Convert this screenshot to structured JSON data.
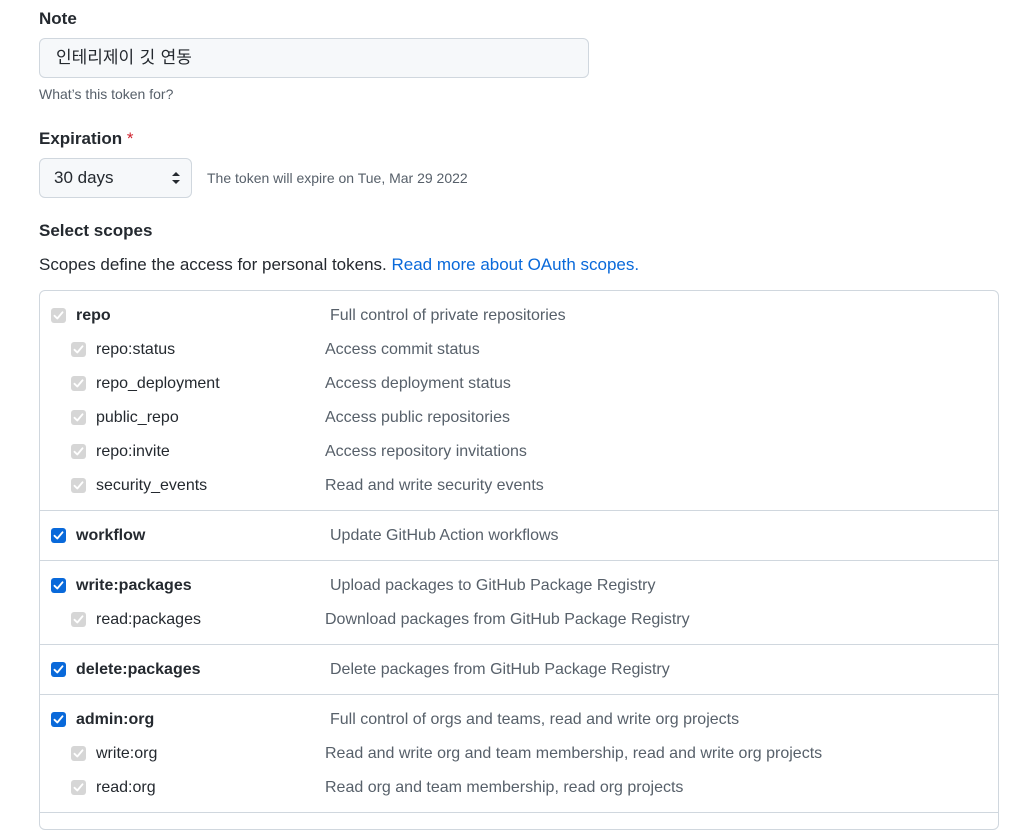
{
  "note": {
    "label": "Note",
    "value": "인테리제이 깃 연동",
    "hint": "What’s this token for?"
  },
  "expiration": {
    "label": "Expiration",
    "required_mark": "*",
    "selected": "30 days",
    "message": "The token will expire on Tue, Mar 29 2022"
  },
  "scopes": {
    "heading": "Select scopes",
    "description": "Scopes define the access for personal tokens.",
    "link": "Read more about OAuth scopes.",
    "groups": [
      {
        "parent": {
          "name": "repo",
          "desc": "Full control of private repositories",
          "checked": true,
          "disabled": true
        },
        "children": [
          {
            "name": "repo:status",
            "desc": "Access commit status"
          },
          {
            "name": "repo_deployment",
            "desc": "Access deployment status"
          },
          {
            "name": "public_repo",
            "desc": "Access public repositories"
          },
          {
            "name": "repo:invite",
            "desc": "Access repository invitations"
          },
          {
            "name": "security_events",
            "desc": "Read and write security events"
          }
        ]
      },
      {
        "parent": {
          "name": "workflow",
          "desc": "Update GitHub Action workflows",
          "checked": true,
          "disabled": false
        },
        "children": []
      },
      {
        "parent": {
          "name": "write:packages",
          "desc": "Upload packages to GitHub Package Registry",
          "checked": true,
          "disabled": false
        },
        "children": [
          {
            "name": "read:packages",
            "desc": "Download packages from GitHub Package Registry"
          }
        ]
      },
      {
        "parent": {
          "name": "delete:packages",
          "desc": "Delete packages from GitHub Package Registry",
          "checked": true,
          "disabled": false
        },
        "children": []
      },
      {
        "parent": {
          "name": "admin:org",
          "desc": "Full control of orgs and teams, read and write org projects",
          "checked": true,
          "disabled": false
        },
        "children": [
          {
            "name": "write:org",
            "desc": "Read and write org and team membership, read and write org projects"
          },
          {
            "name": "read:org",
            "desc": "Read org and team membership, read org projects"
          }
        ]
      }
    ]
  }
}
